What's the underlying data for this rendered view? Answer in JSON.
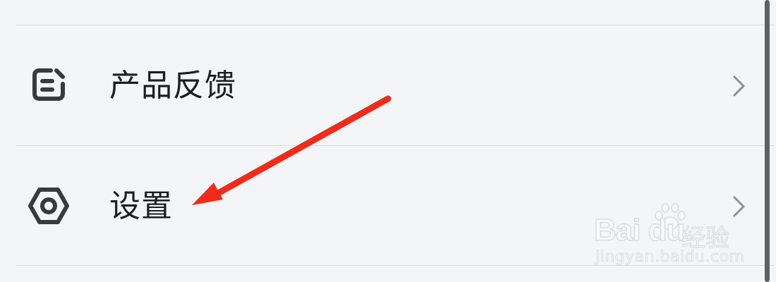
{
  "settings_list": {
    "items": [
      {
        "label": "产品反馈",
        "icon": "feedback-icon"
      },
      {
        "label": "设置",
        "icon": "settings-hexagon-icon"
      }
    ],
    "chevron_icon": "chevron-right-icon"
  },
  "annotation": {
    "arrow_color": "#f02b1c",
    "points_to": "设置"
  },
  "watermark": {
    "brand": "Bai du",
    "product": "经验",
    "url": "jingyan.baidu.com"
  },
  "colors": {
    "background": "#f4f5f7",
    "divider": "#d9dadc",
    "text": "#1d1d1f",
    "icon": "#3a3a3c",
    "chevron": "#8e8e93"
  }
}
